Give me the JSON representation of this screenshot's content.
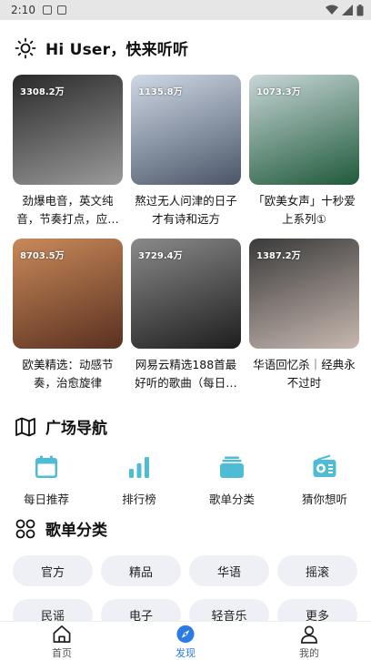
{
  "status_bar": {
    "time": "2:10"
  },
  "greeting": {
    "title": "Hi User，快来听听",
    "icon": "sun-icon"
  },
  "playlists": [
    {
      "play_count": "3308.2万",
      "title": "劲爆电音，英文纯音，节奏打点，应…",
      "cover_colors": [
        "#2a2a2a",
        "#9a9a9a"
      ]
    },
    {
      "play_count": "1135.8万",
      "title": "熬过无人问津的日子才有诗和远方",
      "cover_colors": [
        "#cfd8e6",
        "#4a5668"
      ]
    },
    {
      "play_count": "1073.3万",
      "title": "「欧美女声」十秒爱上系列①",
      "cover_colors": [
        "#c8d6d8",
        "#1f5a3a"
      ]
    },
    {
      "play_count": "8703.5万",
      "title": "欧美精选：动感节奏，治愈旋律",
      "cover_colors": [
        "#c98a5a",
        "#5a3020"
      ]
    },
    {
      "play_count": "3729.4万",
      "title": "网易云精选188首最好听的歌曲（每日…",
      "cover_colors": [
        "#8a8a8a",
        "#1e1e1e"
      ]
    },
    {
      "play_count": "1387.2万",
      "title": "华语回忆杀｜经典永不过时",
      "cover_colors": [
        "#3a3a3a",
        "#c7b8b0"
      ]
    }
  ],
  "nav_section": {
    "title": "广场导航",
    "icon": "map-icon",
    "items": [
      {
        "label": "每日推荐",
        "icon": "calendar-icon"
      },
      {
        "label": "排行榜",
        "icon": "bar-chart-icon"
      },
      {
        "label": "歌单分类",
        "icon": "stack-icon"
      },
      {
        "label": "猜你想听",
        "icon": "radio-icon"
      }
    ],
    "accent": "#4fbcd6"
  },
  "category_section": {
    "title": "歌单分类",
    "icon": "grid-icon",
    "chips": [
      "官方",
      "精品",
      "华语",
      "摇滚",
      "民谣",
      "电子",
      "轻音乐",
      "更多"
    ]
  },
  "tabbar": {
    "tabs": [
      {
        "label": "首页",
        "icon": "home-icon"
      },
      {
        "label": "发现",
        "icon": "discover-icon"
      },
      {
        "label": "我的",
        "icon": "user-icon"
      }
    ],
    "active_color": "#2a7be4"
  }
}
